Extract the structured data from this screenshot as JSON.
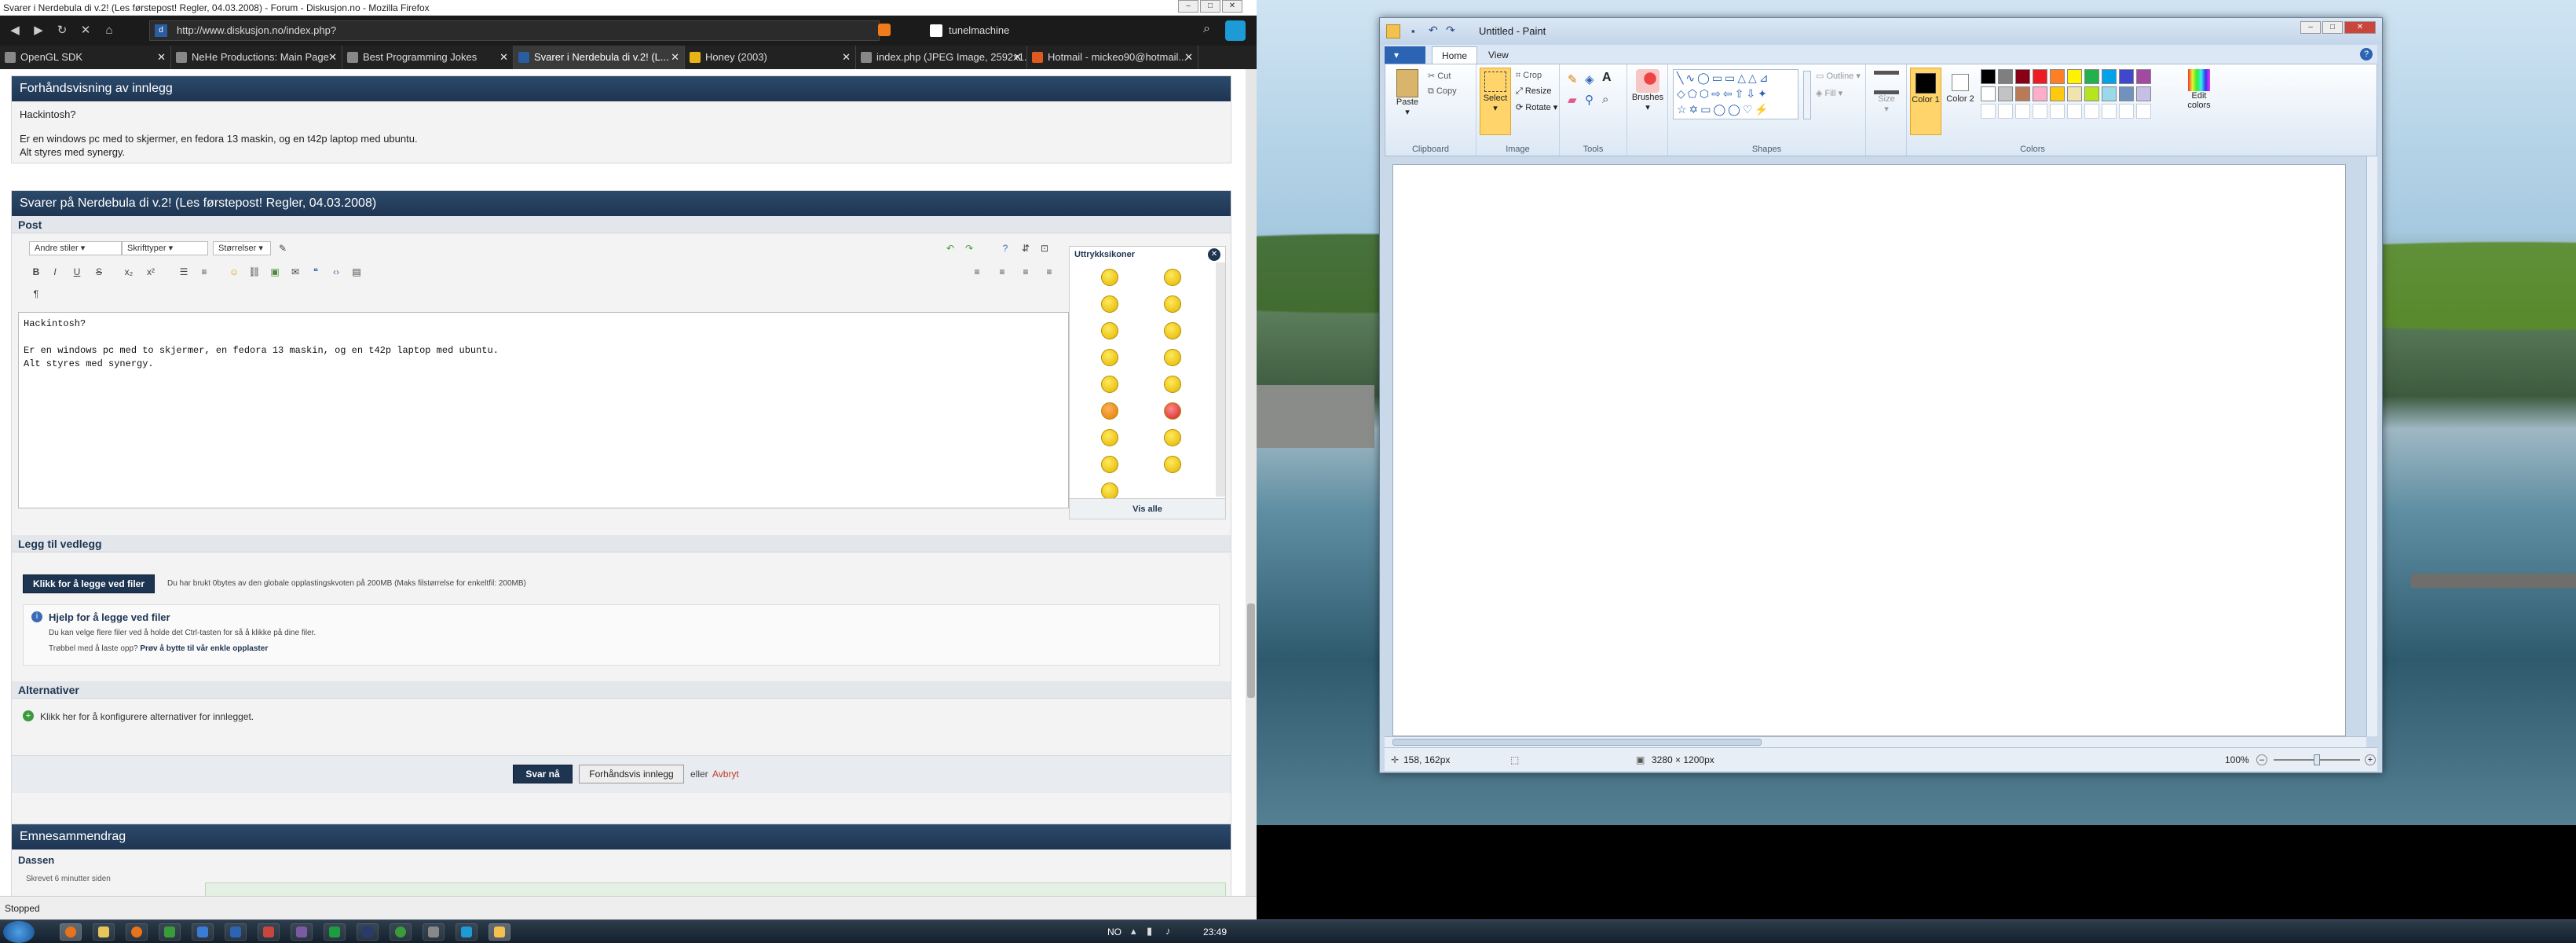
{
  "firefox": {
    "title": "Svarer i Nerdebula di v.2! (Les førstepost! Regler, 04.03.2008) - Forum - Diskusjon.no - Mozilla Firefox",
    "url": "http://www.diskusjon.no/index.php?",
    "search_value": "tunelmachine",
    "status": "Stopped",
    "tabs": [
      {
        "label": "OpenGL SDK",
        "active": false
      },
      {
        "label": "NeHe Productions: Main Page",
        "active": false
      },
      {
        "label": "Best Programming Jokes",
        "active": false
      },
      {
        "label": "Svarer i Nerdebula di v.2! (L...",
        "active": true
      },
      {
        "label": "Honey (2003)",
        "active": false
      },
      {
        "label": "index.php (JPEG Image, 2592x1...",
        "active": false
      },
      {
        "label": "Hotmail - mickeo90@hotmail...",
        "active": false
      }
    ]
  },
  "forum": {
    "preview_header": "Forhåndsvisning av innlegg",
    "preview_lines": [
      "Hackintosh?",
      "",
      "Er en windows pc med to skjermer, en fedora 13 maskin, og en t42p laptop med ubuntu.",
      "Alt styres med synergy."
    ],
    "reply_header": "Svarer på Nerdebula di v.2! (Les førstepost! Regler, 04.03.2008)",
    "post_section": "Post",
    "font_selects": [
      "Andre stiler",
      "Skrifttyper",
      "Størrelser"
    ],
    "editor_lines": [
      "Hackintosh?",
      "",
      "Er en windows pc med to skjermer, en fedora 13 maskin, og en t42p laptop med ubuntu.",
      "Alt styres med synergy."
    ],
    "smileys_title": "Uttrykksikoner",
    "show_all": "Vis alle",
    "attach_section": "Legg til vedlegg",
    "attach_button": "Klikk for å legge ved filer",
    "attach_quota": "Du har brukt 0bytes av den globale opplastingskvoten på 200MB (Maks filstørrelse for enkeltfil: 200MB)",
    "help_title": "Hjelp for å legge ved filer",
    "help_line1": "Du kan velge flere filer ved å holde det Ctrl-tasten for så å klikke på dine filer.",
    "help_line2_prefix": "Trøbbel med å laste opp?",
    "help_line2_link": "Prøv å bytte til vår enkle opplaster",
    "options_section": "Alternativer",
    "options_text": "Klikk her for å konfigurere alternativer for innlegget.",
    "submit_label": "Svar nå",
    "preview_label": "Forhåndsvis innlegg",
    "or_text": "eller",
    "cancel_label": "Avbryt",
    "summary_header": "Emnesammendrag",
    "summary_user": "Dassen",
    "summary_meta": "Skrevet 6 minutter siden"
  },
  "paint": {
    "title": "Untitled - Paint",
    "tabs": [
      "Home",
      "View"
    ],
    "groups": {
      "clipboard": "Clipboard",
      "image": "Image",
      "tools": "Tools",
      "shapes": "Shapes",
      "colors": "Colors"
    },
    "paste_label": "Paste",
    "cut_label": "Cut",
    "copy_label": "Copy",
    "select_label": "Select",
    "crop_label": "Crop",
    "resize_label": "Resize",
    "rotate_label": "Rotate",
    "brushes_label": "Brushes",
    "outline_label": "Outline",
    "fill_label": "Fill",
    "size_label": "Size",
    "color1_label": "Color 1",
    "color2_label": "Color 2",
    "edit_colors_label": "Edit colors",
    "status_pos": "158, 162px",
    "status_size": "3280 × 1200px",
    "zoom": "100%",
    "palette": [
      "#000000",
      "#7f7f7f",
      "#880015",
      "#ed1c24",
      "#ff7f27",
      "#fff200",
      "#22b14c",
      "#00a2e8",
      "#3f48cc",
      "#a349a4",
      "#ffffff",
      "#c3c3c3",
      "#b97a57",
      "#ffaec9",
      "#ffc90e",
      "#efe4b0",
      "#b5e61d",
      "#99d9ea",
      "#7092be",
      "#c8bfe7"
    ]
  },
  "taskbar": {
    "lang": "NO",
    "clock": "23:49"
  }
}
